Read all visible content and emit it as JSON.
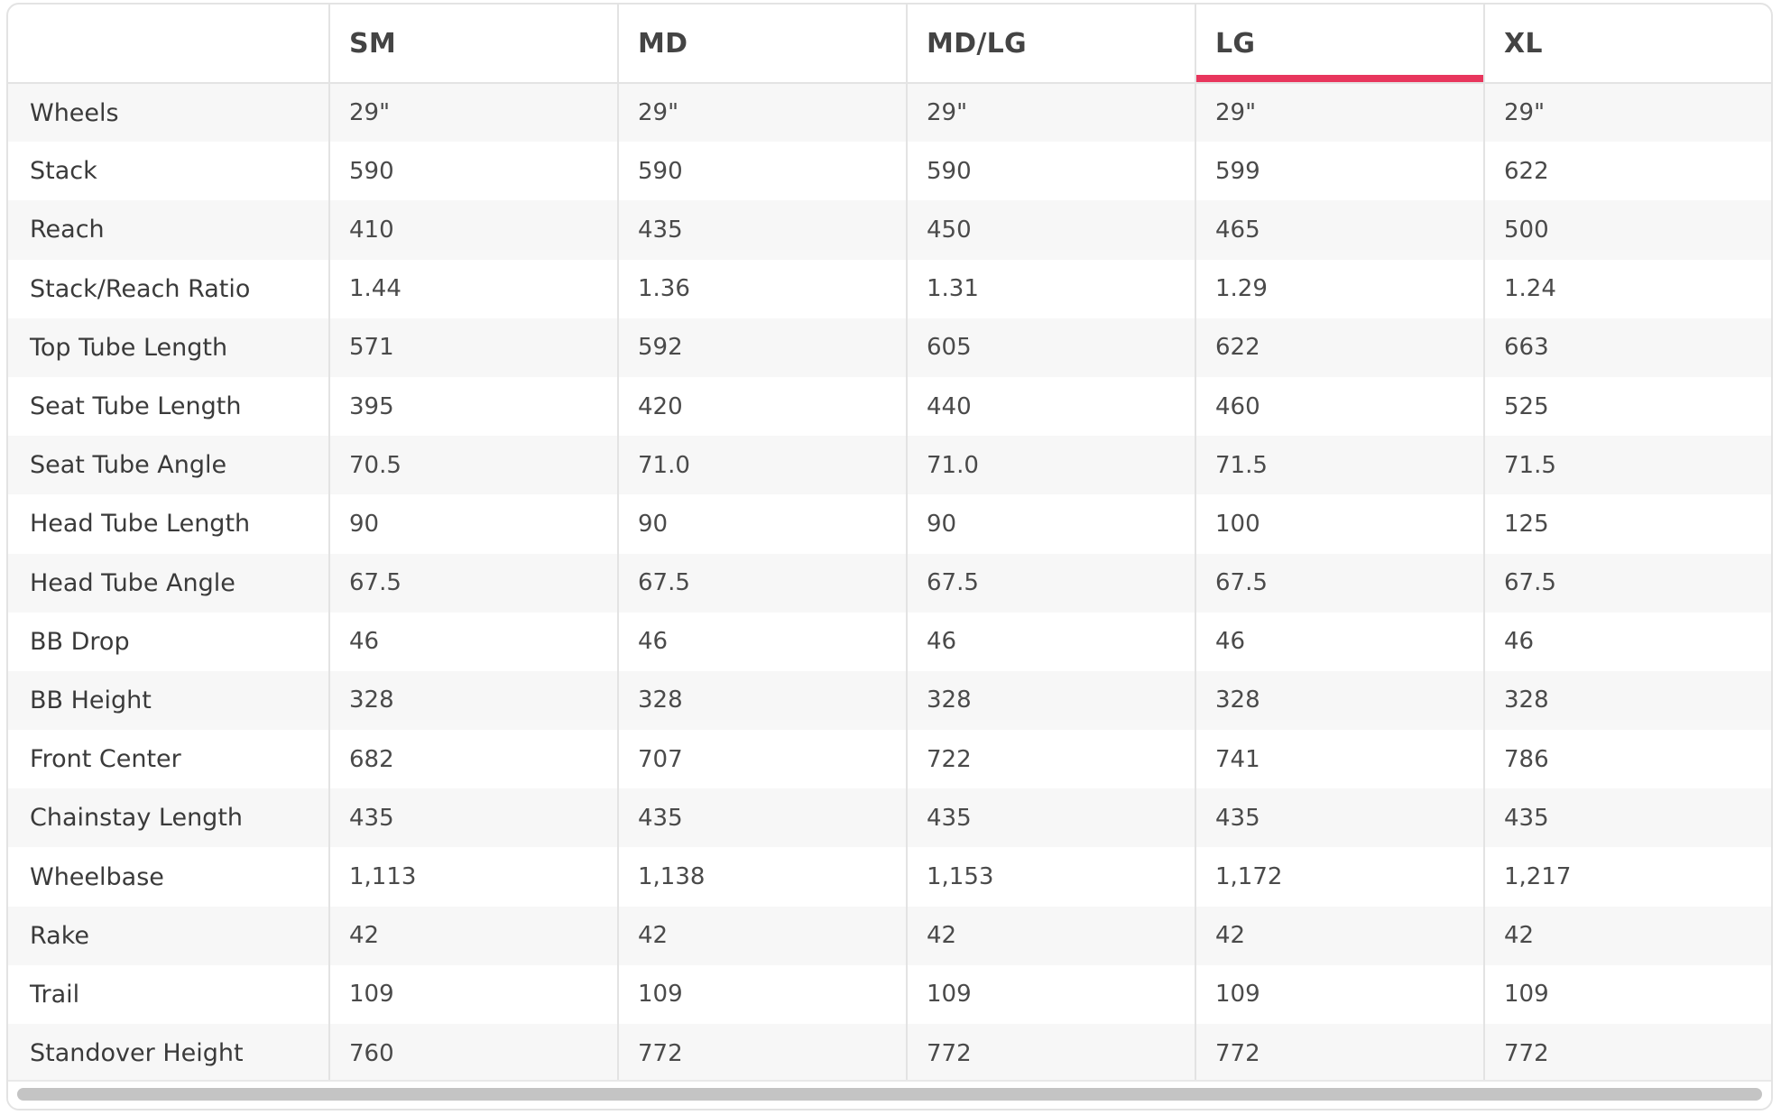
{
  "colors": {
    "accent": "#e8365d",
    "stripe": "#f7f7f7",
    "border": "#e3e3e3"
  },
  "table": {
    "corner_label": "",
    "active_size_index": 3,
    "sizes": [
      "SM",
      "MD",
      "MD/LG",
      "LG",
      "XL"
    ],
    "rows": [
      {
        "label": "Wheels",
        "values": [
          "29\"",
          "29\"",
          "29\"",
          "29\"",
          "29\""
        ]
      },
      {
        "label": "Stack",
        "values": [
          "590",
          "590",
          "590",
          "599",
          "622"
        ]
      },
      {
        "label": "Reach",
        "values": [
          "410",
          "435",
          "450",
          "465",
          "500"
        ]
      },
      {
        "label": "Stack/Reach Ratio",
        "values": [
          "1.44",
          "1.36",
          "1.31",
          "1.29",
          "1.24"
        ]
      },
      {
        "label": "Top Tube Length",
        "values": [
          "571",
          "592",
          "605",
          "622",
          "663"
        ]
      },
      {
        "label": "Seat Tube Length",
        "values": [
          "395",
          "420",
          "440",
          "460",
          "525"
        ]
      },
      {
        "label": "Seat Tube Angle",
        "values": [
          "70.5",
          "71.0",
          "71.0",
          "71.5",
          "71.5"
        ]
      },
      {
        "label": "Head Tube Length",
        "values": [
          "90",
          "90",
          "90",
          "100",
          "125"
        ]
      },
      {
        "label": "Head Tube Angle",
        "values": [
          "67.5",
          "67.5",
          "67.5",
          "67.5",
          "67.5"
        ]
      },
      {
        "label": "BB Drop",
        "values": [
          "46",
          "46",
          "46",
          "46",
          "46"
        ]
      },
      {
        "label": "BB Height",
        "values": [
          "328",
          "328",
          "328",
          "328",
          "328"
        ]
      },
      {
        "label": "Front Center",
        "values": [
          "682",
          "707",
          "722",
          "741",
          "786"
        ]
      },
      {
        "label": "Chainstay Length",
        "values": [
          "435",
          "435",
          "435",
          "435",
          "435"
        ]
      },
      {
        "label": "Wheelbase",
        "values": [
          "1,113",
          "1,138",
          "1,153",
          "1,172",
          "1,217"
        ]
      },
      {
        "label": "Rake",
        "values": [
          "42",
          "42",
          "42",
          "42",
          "42"
        ]
      },
      {
        "label": "Trail",
        "values": [
          "109",
          "109",
          "109",
          "109",
          "109"
        ]
      },
      {
        "label": "Standover Height",
        "values": [
          "760",
          "772",
          "772",
          "772",
          "772"
        ]
      }
    ]
  }
}
